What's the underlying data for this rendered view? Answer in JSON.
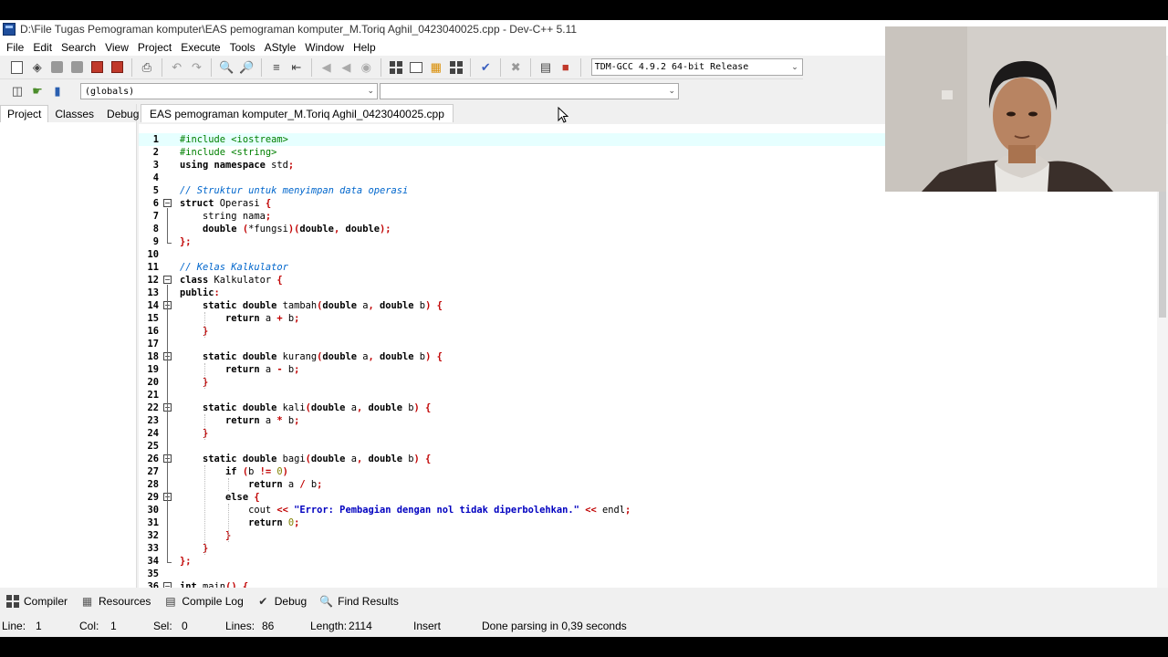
{
  "window": {
    "title": "D:\\File Tugas Pemograman komputer\\EAS pemograman komputer_M.Toriq Aghil_0423040025.cpp - Dev-C++ 5.11"
  },
  "menu": [
    "File",
    "Edit",
    "Search",
    "View",
    "Project",
    "Execute",
    "Tools",
    "AStyle",
    "Window",
    "Help"
  ],
  "toolbar": {
    "compiler": "TDM-GCC 4.9.2 64-bit Release",
    "icons": [
      "new-file-icon",
      "open-project-icon",
      "save-icon",
      "save-all-icon",
      "close-icon",
      "close-all-icon",
      "print-icon",
      "undo-icon",
      "redo-icon",
      "find-icon",
      "replace-icon",
      "indent-icon",
      "unindent-icon",
      "goto-back-icon",
      "goto-forward-icon",
      "bookmark-icon",
      "compile-icon",
      "run-icon",
      "compile-run-icon",
      "rebuild-icon",
      "syntax-check-icon",
      "stop-icon",
      "chart-icon",
      "debug-icon"
    ]
  },
  "scope_bar": {
    "globals": "(globals)",
    "members": ""
  },
  "left_tabs": [
    "Project",
    "Classes",
    "Debug"
  ],
  "editor": {
    "tab": "EAS pemograman komputer_M.Toriq Aghil_0423040025.cpp",
    "lines": [
      {
        "n": "1",
        "tokens": [
          [
            "pp",
            "#include <iostream>"
          ]
        ]
      },
      {
        "n": "2",
        "tokens": [
          [
            "pp",
            "#include <string>"
          ]
        ]
      },
      {
        "n": "3",
        "tokens": [
          [
            "kw",
            "using namespace"
          ],
          [
            "id",
            " std"
          ],
          [
            "sy",
            ";"
          ]
        ]
      },
      {
        "n": "4",
        "tokens": []
      },
      {
        "n": "5",
        "tokens": [
          [
            "cm",
            "// Struktur untuk menyimpan data operasi"
          ]
        ]
      },
      {
        "n": "6",
        "tokens": [
          [
            "kw",
            "struct"
          ],
          [
            "id",
            " Operasi "
          ],
          [
            "sy",
            "{"
          ]
        ]
      },
      {
        "n": "7",
        "tokens": [
          [
            "id",
            "    string nama"
          ],
          [
            "sy",
            ";"
          ]
        ]
      },
      {
        "n": "8",
        "tokens": [
          [
            "kw",
            "    double "
          ],
          [
            "sy",
            "("
          ],
          [
            "id",
            "*fungsi"
          ],
          [
            "sy",
            ")("
          ],
          [
            "kw",
            "double"
          ],
          [
            "sy",
            ", "
          ],
          [
            "kw",
            "double"
          ],
          [
            "sy",
            ");"
          ]
        ]
      },
      {
        "n": "9",
        "tokens": [
          [
            "sy",
            "};"
          ]
        ]
      },
      {
        "n": "10",
        "tokens": []
      },
      {
        "n": "11",
        "tokens": [
          [
            "cm",
            "// Kelas Kalkulator"
          ]
        ]
      },
      {
        "n": "12",
        "tokens": [
          [
            "kw",
            "class"
          ],
          [
            "id",
            " Kalkulator "
          ],
          [
            "sy",
            "{"
          ]
        ]
      },
      {
        "n": "13",
        "tokens": [
          [
            "kw",
            "public"
          ],
          [
            "sy",
            ":"
          ]
        ]
      },
      {
        "n": "14",
        "tokens": [
          [
            "kw",
            "    static double"
          ],
          [
            "id",
            " tambah"
          ],
          [
            "sy",
            "("
          ],
          [
            "kw",
            "double"
          ],
          [
            "id",
            " a"
          ],
          [
            "sy",
            ", "
          ],
          [
            "kw",
            "double"
          ],
          [
            "id",
            " b"
          ],
          [
            "sy",
            ") {"
          ]
        ]
      },
      {
        "n": "15",
        "tokens": [
          [
            "kw",
            "        return"
          ],
          [
            "id",
            " a "
          ],
          [
            "sy",
            "+"
          ],
          [
            "id",
            " b"
          ],
          [
            "sy",
            ";"
          ]
        ]
      },
      {
        "n": "16",
        "tokens": [
          [
            "sy",
            "    }"
          ]
        ]
      },
      {
        "n": "17",
        "tokens": []
      },
      {
        "n": "18",
        "tokens": [
          [
            "kw",
            "    static double"
          ],
          [
            "id",
            " kurang"
          ],
          [
            "sy",
            "("
          ],
          [
            "kw",
            "double"
          ],
          [
            "id",
            " a"
          ],
          [
            "sy",
            ", "
          ],
          [
            "kw",
            "double"
          ],
          [
            "id",
            " b"
          ],
          [
            "sy",
            ") {"
          ]
        ]
      },
      {
        "n": "19",
        "tokens": [
          [
            "kw",
            "        return"
          ],
          [
            "id",
            " a "
          ],
          [
            "sy",
            "-"
          ],
          [
            "id",
            " b"
          ],
          [
            "sy",
            ";"
          ]
        ]
      },
      {
        "n": "20",
        "tokens": [
          [
            "sy",
            "    }"
          ]
        ]
      },
      {
        "n": "21",
        "tokens": []
      },
      {
        "n": "22",
        "tokens": [
          [
            "kw",
            "    static double"
          ],
          [
            "id",
            " kali"
          ],
          [
            "sy",
            "("
          ],
          [
            "kw",
            "double"
          ],
          [
            "id",
            " a"
          ],
          [
            "sy",
            ", "
          ],
          [
            "kw",
            "double"
          ],
          [
            "id",
            " b"
          ],
          [
            "sy",
            ") {"
          ]
        ]
      },
      {
        "n": "23",
        "tokens": [
          [
            "kw",
            "        return"
          ],
          [
            "id",
            " a "
          ],
          [
            "sy",
            "*"
          ],
          [
            "id",
            " b"
          ],
          [
            "sy",
            ";"
          ]
        ]
      },
      {
        "n": "24",
        "tokens": [
          [
            "sy",
            "    }"
          ]
        ]
      },
      {
        "n": "25",
        "tokens": []
      },
      {
        "n": "26",
        "tokens": [
          [
            "kw",
            "    static double"
          ],
          [
            "id",
            " bagi"
          ],
          [
            "sy",
            "("
          ],
          [
            "kw",
            "double"
          ],
          [
            "id",
            " a"
          ],
          [
            "sy",
            ", "
          ],
          [
            "kw",
            "double"
          ],
          [
            "id",
            " b"
          ],
          [
            "sy",
            ") {"
          ]
        ]
      },
      {
        "n": "27",
        "tokens": [
          [
            "kw",
            "        if"
          ],
          [
            "sy",
            " ("
          ],
          [
            "id",
            "b "
          ],
          [
            "sy",
            "!="
          ],
          [
            "id",
            " "
          ],
          [
            "nm",
            "0"
          ],
          [
            "sy",
            ")"
          ]
        ]
      },
      {
        "n": "28",
        "tokens": [
          [
            "kw",
            "            return"
          ],
          [
            "id",
            " a "
          ],
          [
            "sy",
            "/"
          ],
          [
            "id",
            " b"
          ],
          [
            "sy",
            ";"
          ]
        ]
      },
      {
        "n": "29",
        "tokens": [
          [
            "kw",
            "        else"
          ],
          [
            "sy",
            " {"
          ]
        ]
      },
      {
        "n": "30",
        "tokens": [
          [
            "id",
            "            cout "
          ],
          [
            "sy",
            "<<"
          ],
          [
            "id",
            " "
          ],
          [
            "st",
            "\"Error: Pembagian dengan nol tidak diperbolehkan.\""
          ],
          [
            "id",
            " "
          ],
          [
            "sy",
            "<<"
          ],
          [
            "id",
            " endl"
          ],
          [
            "sy",
            ";"
          ]
        ]
      },
      {
        "n": "31",
        "tokens": [
          [
            "kw",
            "            return"
          ],
          [
            "id",
            " "
          ],
          [
            "nm",
            "0"
          ],
          [
            "sy",
            ";"
          ]
        ]
      },
      {
        "n": "32",
        "tokens": [
          [
            "sy",
            "        }"
          ]
        ]
      },
      {
        "n": "33",
        "tokens": [
          [
            "sy",
            "    }"
          ]
        ]
      },
      {
        "n": "34",
        "tokens": [
          [
            "sy",
            "};"
          ]
        ]
      },
      {
        "n": "35",
        "tokens": []
      },
      {
        "n": "36",
        "tokens": [
          [
            "kw",
            "int"
          ],
          [
            "id",
            " main"
          ],
          [
            "sy",
            "() {"
          ]
        ]
      }
    ]
  },
  "bottom_tabs": [
    {
      "label": "Compiler",
      "icon": "compiler-grid-icon"
    },
    {
      "label": "Resources",
      "icon": "resources-icon"
    },
    {
      "label": "Compile Log",
      "icon": "compile-log-chart-icon"
    },
    {
      "label": "Debug",
      "icon": "debug-check-icon"
    },
    {
      "label": "Find Results",
      "icon": "find-results-icon"
    }
  ],
  "status": {
    "line_label": "Line:",
    "line": "1",
    "col_label": "Col:",
    "col": "1",
    "sel_label": "Sel:",
    "sel": "0",
    "lines_label": "Lines:",
    "lines": "86",
    "length_label": "Length:",
    "length": "2114",
    "mode": "Insert",
    "message": "Done parsing in 0,39 seconds"
  }
}
